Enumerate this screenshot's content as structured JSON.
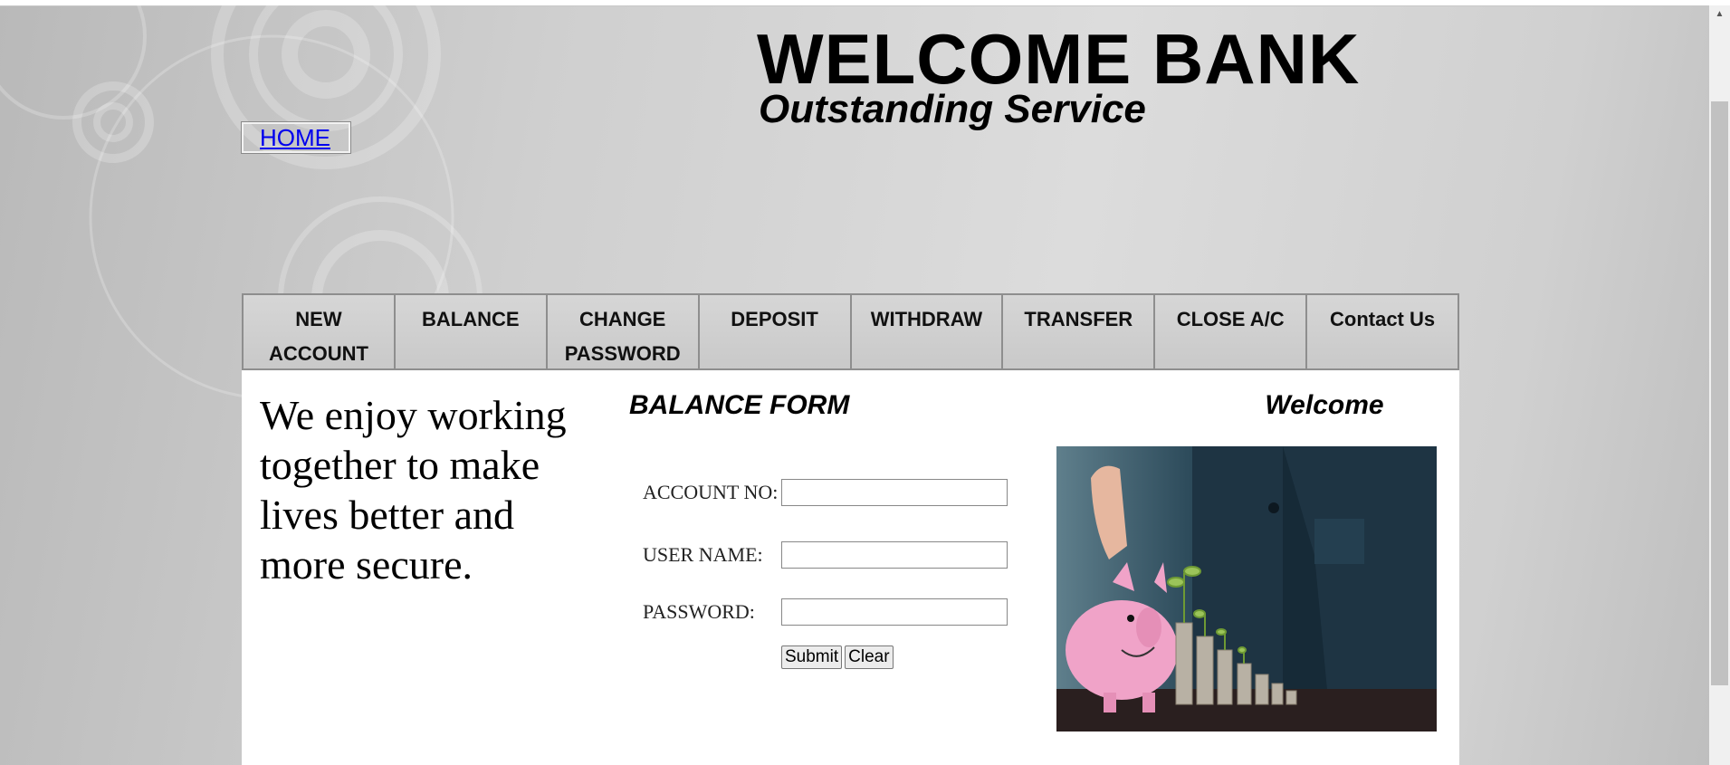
{
  "header": {
    "title": "WELCOME BANK",
    "subtitle": "Outstanding Service"
  },
  "home_link": "HOME",
  "nav": {
    "items": [
      {
        "label": "NEW ACCOUNT"
      },
      {
        "label": "BALANCE"
      },
      {
        "label": "CHANGE PASSWORD"
      },
      {
        "label": "DEPOSIT"
      },
      {
        "label": "WITHDRAW"
      },
      {
        "label": "TRANSFER"
      },
      {
        "label": "CLOSE A/C"
      },
      {
        "label": "Contact Us"
      }
    ]
  },
  "tagline": "We enjoy working together to make lives better and more secure.",
  "form": {
    "title": "BALANCE FORM",
    "account_label": "ACCOUNT NO:",
    "account_value": "",
    "username_label": "USER NAME:",
    "username_value": "",
    "password_label": "PASSWORD:",
    "password_value": "",
    "submit_label": "Submit",
    "clear_label": "Clear"
  },
  "welcome_title": "Welcome",
  "colors": {
    "link": "#0000ee",
    "nav_border": "#8e8e8e",
    "content_bg": "#ffffff"
  }
}
